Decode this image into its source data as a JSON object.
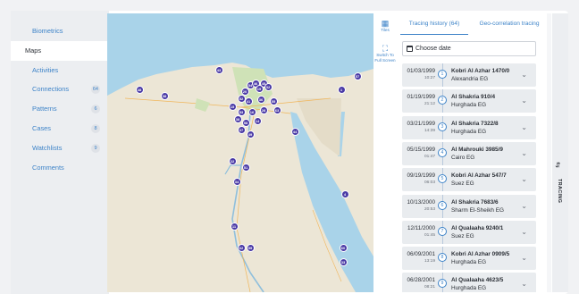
{
  "sidebar": {
    "items": [
      {
        "label": "Biometrics",
        "badge": ""
      },
      {
        "label": "Maps",
        "badge": ""
      },
      {
        "label": "Activities",
        "badge": ""
      },
      {
        "label": "Connections",
        "badge": "64"
      },
      {
        "label": "Patterns",
        "badge": "6"
      },
      {
        "label": "Cases",
        "badge": "8"
      },
      {
        "label": "Watchlists",
        "badge": "9"
      },
      {
        "label": "Comments",
        "badge": ""
      }
    ]
  },
  "map": {
    "tools": [
      {
        "label": "Tiles",
        "icon": "grid-icon"
      },
      {
        "label": "Switch To Full Screen",
        "icon": "fullscreen-icon"
      }
    ],
    "markers": [
      "48",
      "38",
      "43",
      "20",
      "54",
      "46",
      "45",
      "19",
      "32",
      "52",
      "41",
      "36",
      "55",
      "15",
      "53",
      "16",
      "28",
      "63",
      "38",
      "58",
      "14",
      "37",
      "49",
      "44",
      "22",
      "51",
      "34",
      "4",
      "11",
      "62",
      "59",
      "60",
      "1",
      "57",
      "33"
    ]
  },
  "panel": {
    "tabs": [
      "Tracing history (64)",
      "Geo-correlation tracing"
    ],
    "date_placeholder": "Choose date",
    "rows": [
      {
        "date": "01/03/1999",
        "time": "10:27",
        "num": "1",
        "addr": "Kobri Al Azhar 1470/0",
        "city": "Alexandria EG"
      },
      {
        "date": "01/19/1999",
        "time": "21:12",
        "num": "2",
        "addr": "Al Shakria 910/4",
        "city": "Hurghada EG"
      },
      {
        "date": "03/21/1999",
        "time": "14:39",
        "num": "3",
        "addr": "Al Shakria 7322/8",
        "city": "Hurghada EG"
      },
      {
        "date": "05/15/1999",
        "time": "01:47",
        "num": "4",
        "addr": "Al Mahrouki 3985/9",
        "city": "Cairo EG"
      },
      {
        "date": "09/19/1999",
        "time": "06:03",
        "num": "5",
        "addr": "Kobri Al Azhar 547/7",
        "city": "Suez EG"
      },
      {
        "date": "10/13/2000",
        "time": "20:53",
        "num": "6",
        "addr": "Al Shakria 7683/6",
        "city": "Sharm El-Sheikh EG"
      },
      {
        "date": "12/11/2000",
        "time": "01:45",
        "num": "7",
        "addr": "Al Qualaaha 9240/1",
        "city": "Suez EG"
      },
      {
        "date": "06/09/2001",
        "time": "13:19",
        "num": "8",
        "addr": "Kobri Al Azhar 0909/5",
        "city": "Hurghada EG"
      },
      {
        "date": "06/28/2001",
        "time": "08:21",
        "num": "9",
        "addr": "Al Qualaaha 4623/5",
        "city": "Hurghada EG"
      }
    ]
  },
  "side_tab": {
    "label": "TRACING",
    "icon": "route-icon"
  },
  "colors": {
    "accent": "#3d83c8",
    "marker": "#4a3aa6",
    "sea": "#a9d3e9",
    "land": "#e9e4d8"
  }
}
